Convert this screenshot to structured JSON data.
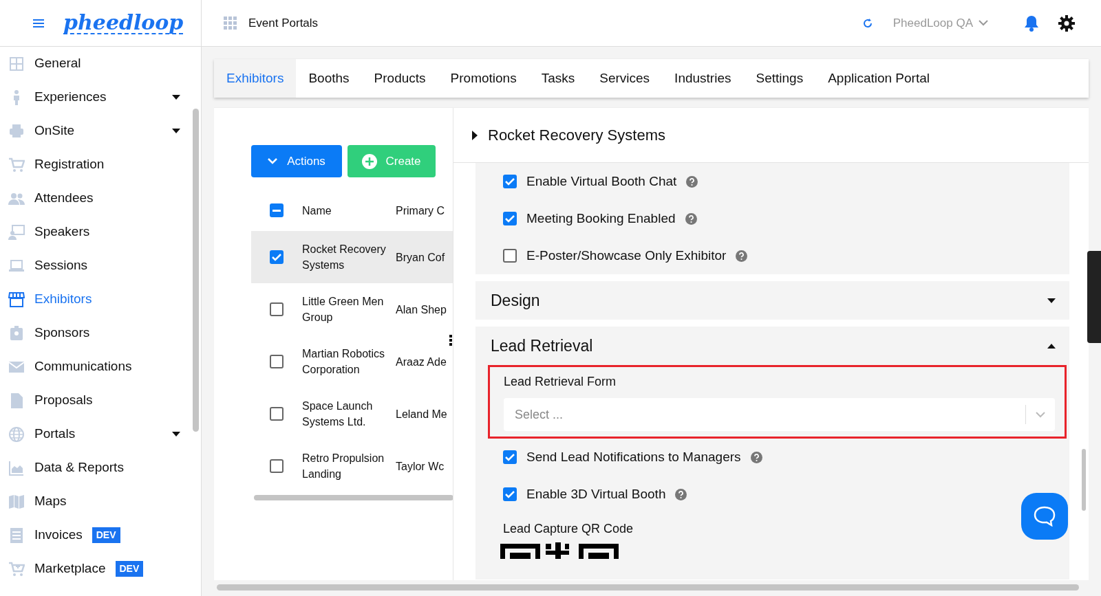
{
  "header": {
    "logo": "pheedloop",
    "app_title": "Event Portals",
    "account": "PheedLoop QA"
  },
  "sidebar": {
    "items": [
      {
        "label": "General",
        "expandable": false,
        "selected": false
      },
      {
        "label": "Experiences",
        "expandable": true,
        "selected": false
      },
      {
        "label": "OnSite",
        "expandable": true,
        "selected": false
      },
      {
        "label": "Registration",
        "expandable": false,
        "selected": false
      },
      {
        "label": "Attendees",
        "expandable": false,
        "selected": false
      },
      {
        "label": "Speakers",
        "expandable": false,
        "selected": false
      },
      {
        "label": "Sessions",
        "expandable": false,
        "selected": false
      },
      {
        "label": "Exhibitors",
        "expandable": false,
        "selected": true
      },
      {
        "label": "Sponsors",
        "expandable": false,
        "selected": false
      },
      {
        "label": "Communications",
        "expandable": false,
        "selected": false
      },
      {
        "label": "Proposals",
        "expandable": false,
        "selected": false
      },
      {
        "label": "Portals",
        "expandable": true,
        "selected": false
      },
      {
        "label": "Data & Reports",
        "expandable": false,
        "selected": false
      },
      {
        "label": "Maps",
        "expandable": false,
        "selected": false
      },
      {
        "label": "Invoices",
        "expandable": false,
        "selected": false,
        "badge": "DEV"
      },
      {
        "label": "Marketplace",
        "expandable": false,
        "selected": false,
        "badge": "DEV"
      }
    ]
  },
  "tabs": [
    {
      "label": "Exhibitors",
      "selected": true
    },
    {
      "label": "Booths",
      "selected": false
    },
    {
      "label": "Products",
      "selected": false
    },
    {
      "label": "Promotions",
      "selected": false
    },
    {
      "label": "Tasks",
      "selected": false
    },
    {
      "label": "Services",
      "selected": false
    },
    {
      "label": "Industries",
      "selected": false
    },
    {
      "label": "Settings",
      "selected": false
    },
    {
      "label": "Application Portal",
      "selected": false
    }
  ],
  "toolbar": {
    "actions": "Actions",
    "create": "Create"
  },
  "table": {
    "select_all": {
      "indeterminate": true
    },
    "columns": [
      "Name",
      "Primary C"
    ],
    "rows": [
      {
        "name": "Rocket Recovery Systems",
        "contact": "Bryan Cof",
        "checked": true,
        "selected": true
      },
      {
        "name": "Little Green Men Group",
        "contact": "Alan Shep",
        "checked": false,
        "selected": false
      },
      {
        "name": "Martian Robotics Corporation",
        "contact": "Araaz Ade",
        "checked": false,
        "selected": false
      },
      {
        "name": "Space Launch Systems Ltd.",
        "contact": "Leland Me",
        "checked": false,
        "selected": false
      },
      {
        "name": "Retro Propulsion Landing",
        "contact": "Taylor Wc",
        "checked": false,
        "selected": false
      }
    ]
  },
  "detail": {
    "title": "Rocket Recovery Systems",
    "expanded": false,
    "blocks": [
      {
        "kind": "option",
        "label": "Enable Virtual Booth Chat",
        "checked": true
      },
      {
        "kind": "option",
        "label": "Meeting Booking Enabled",
        "checked": true
      },
      {
        "kind": "option",
        "label": "E-Poster/Showcase Only Exhibitor",
        "checked": false
      },
      {
        "kind": "section",
        "title": "Design",
        "expanded": false
      },
      {
        "kind": "section",
        "title": "Lead Retrieval",
        "expanded": true
      },
      {
        "kind": "select",
        "label": "Lead Retrieval Form",
        "placeholder": "Select ...",
        "highlighted": true
      },
      {
        "kind": "option",
        "label": "Send Lead Notifications to Managers",
        "checked": true
      },
      {
        "kind": "option",
        "label": "Enable 3D Virtual Booth",
        "checked": true
      },
      {
        "kind": "qr",
        "label": "Lead Capture QR Code"
      }
    ]
  }
}
